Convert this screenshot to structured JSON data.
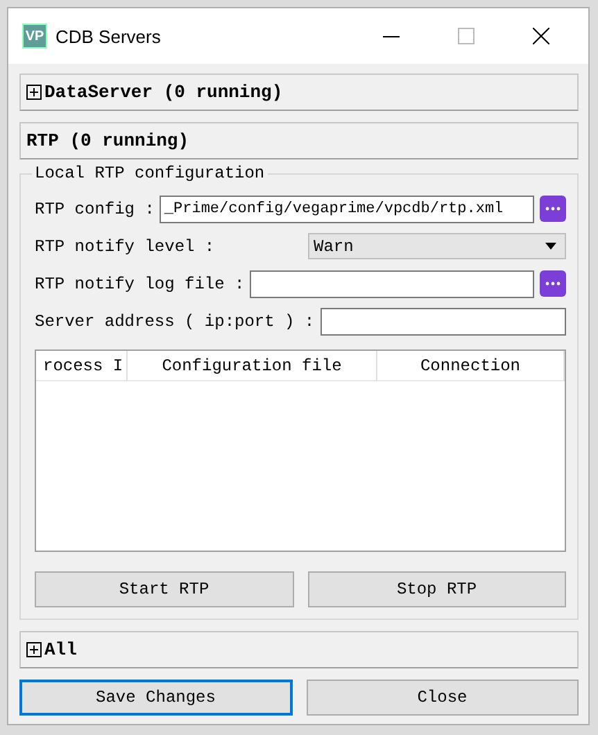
{
  "window": {
    "title": "CDB Servers",
    "icon_text": "VP"
  },
  "sections": [
    {
      "title": "DataServer (0 running)",
      "expanded": false
    },
    {
      "title": "RTP (0 running)",
      "expanded": true,
      "group": {
        "title": "Local RTP configuration",
        "fields": [
          {
            "kind": "path",
            "label": "RTP config :",
            "value": "_Prime/config/vegaprime/vpcdb/rtp.xml"
          },
          {
            "kind": "select",
            "label": "RTP notify level :",
            "value": "Warn"
          },
          {
            "kind": "path",
            "label": "RTP notify log file :"
          },
          {
            "kind": "text",
            "label": "Server address ( ip:port ) :"
          }
        ],
        "table": {
          "columns": [
            "rocess I",
            "Configuration file",
            "Connection"
          ]
        },
        "buttons": [
          "Start RTP",
          "Stop RTP"
        ]
      }
    },
    {
      "title": "All",
      "expanded": false
    }
  ],
  "buttons": [
    {
      "label": "Save Changes",
      "focused": true
    },
    {
      "label": "Close",
      "focused": false
    }
  ]
}
